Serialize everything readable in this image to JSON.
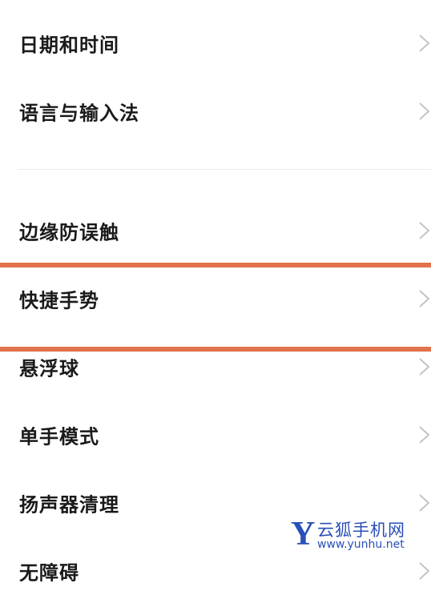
{
  "settings_list": {
    "items": [
      {
        "label": "日期和时间"
      },
      {
        "label": "语言与输入法"
      },
      {
        "label": "边缘防误触"
      },
      {
        "label": "快捷手势"
      },
      {
        "label": "悬浮球"
      },
      {
        "label": "单手模式"
      },
      {
        "label": "扬声器清理"
      },
      {
        "label": "无障碍"
      }
    ]
  },
  "icons": {
    "chevron": "chevron-right-icon"
  },
  "highlight": {
    "color": "#e0734a"
  },
  "watermark": {
    "logo_letter": "Y",
    "name": "云狐手机网",
    "url": "www.yunhu.net"
  }
}
